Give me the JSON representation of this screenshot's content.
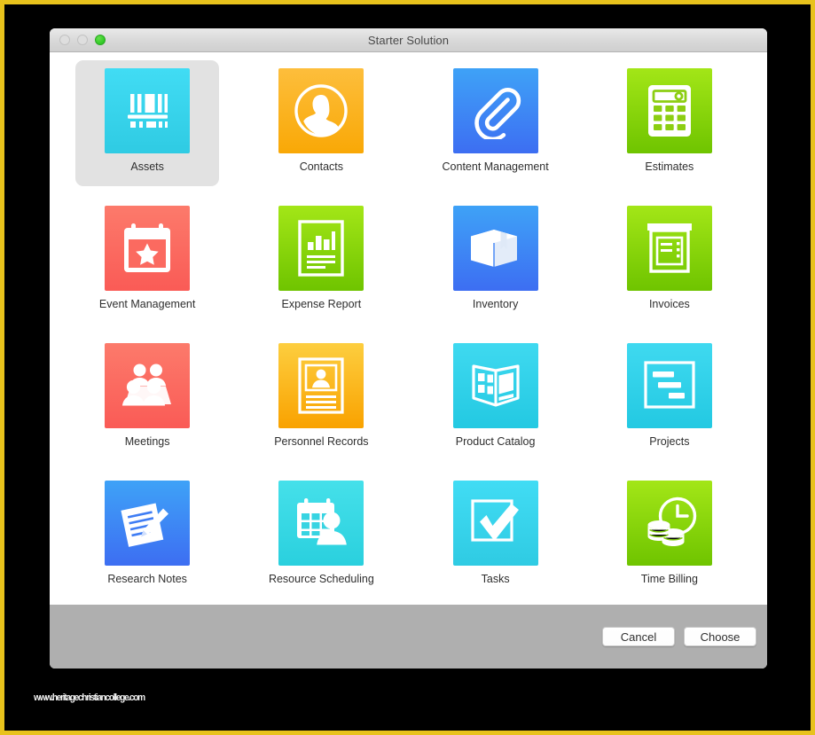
{
  "window": {
    "title": "Starter Solution",
    "controls": [
      {
        "name": "close-button",
        "label": "Close"
      },
      {
        "name": "minimize-button",
        "label": "Minimize"
      },
      {
        "name": "zoom-button",
        "label": "Zoom"
      }
    ]
  },
  "grid": {
    "selected_index": 0,
    "items": [
      {
        "label": "Assets",
        "icon": "barcode-shelf-icon",
        "color_start": "#41DCF4",
        "color_end": "#2FCBE3",
        "selected": true
      },
      {
        "label": "Contacts",
        "icon": "person-circle-icon",
        "color_start": "#FDBE3C",
        "color_end": "#F9A806",
        "selected": false
      },
      {
        "label": "Content Management",
        "icon": "paperclip-icon",
        "color_start": "#3EA2F7",
        "color_end": "#3D6EF2",
        "selected": false
      },
      {
        "label": "Estimates",
        "icon": "calculator-icon",
        "color_start": "#A3E617",
        "color_end": "#6FC400",
        "selected": false
      },
      {
        "label": "Event Management",
        "icon": "calendar-star-icon",
        "color_start": "#FC7A6B",
        "color_end": "#FA5B56",
        "selected": false
      },
      {
        "label": "Expense Report",
        "icon": "report-chart-icon",
        "color_start": "#A3E617",
        "color_end": "#6FC400",
        "selected": false
      },
      {
        "label": "Inventory",
        "icon": "box-3d-icon",
        "color_start": "#3EA2F7",
        "color_end": "#3D6EF2",
        "selected": false
      },
      {
        "label": "Invoices",
        "icon": "invoice-icon",
        "color_start": "#A3E617",
        "color_end": "#6FC400",
        "selected": false
      },
      {
        "label": "Meetings",
        "icon": "people-group-icon",
        "color_start": "#FC7A6B",
        "color_end": "#FA5B56",
        "selected": false
      },
      {
        "label": "Personnel Records",
        "icon": "id-card-icon",
        "color_start": "#FDCE3F",
        "color_end": "#F9A200",
        "selected": false
      },
      {
        "label": "Product Catalog",
        "icon": "open-catalog-icon",
        "color_start": "#3FD9F0",
        "color_end": "#23C9E2",
        "selected": false
      },
      {
        "label": "Projects",
        "icon": "gantt-chart-icon",
        "color_start": "#3FD9F0",
        "color_end": "#23C9E2",
        "selected": false
      },
      {
        "label": "Research Notes",
        "icon": "note-pencil-icon",
        "color_start": "#3EA2F7",
        "color_end": "#3D6EF2",
        "selected": false
      },
      {
        "label": "Resource Scheduling",
        "icon": "calendar-person-icon",
        "color_start": "#45E0EA",
        "color_end": "#2AD0DE",
        "selected": false
      },
      {
        "label": "Tasks",
        "icon": "checkbox-check-icon",
        "color_start": "#41DCF4",
        "color_end": "#2FCBE3",
        "selected": false
      },
      {
        "label": "Time Billing",
        "icon": "clock-coins-icon",
        "color_start": "#A3E617",
        "color_end": "#6FC400",
        "selected": false
      }
    ]
  },
  "footer": {
    "cancel_label": "Cancel",
    "choose_label": "Choose"
  },
  "watermark": {
    "text": "www.heritagechristiancollege.com"
  },
  "colors": {
    "frame": "#E8C21C",
    "backdrop": "#000000",
    "footer_bg": "#AFAFAF",
    "selection_bg": "#E2E2E2"
  }
}
